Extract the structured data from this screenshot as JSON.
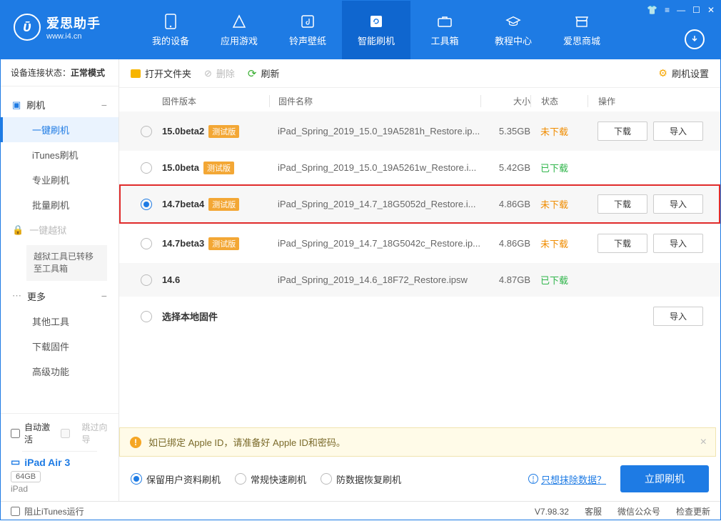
{
  "brand": {
    "name": "爱思助手",
    "site": "www.i4.cn"
  },
  "nav": {
    "items": [
      {
        "label": "我的设备"
      },
      {
        "label": "应用游戏"
      },
      {
        "label": "铃声壁纸"
      },
      {
        "label": "智能刷机"
      },
      {
        "label": "工具箱"
      },
      {
        "label": "教程中心"
      },
      {
        "label": "爱思商城"
      }
    ]
  },
  "sidebar": {
    "conn_label": "设备连接状态：",
    "conn_value": "正常模式",
    "flash_section": "刷机",
    "items": {
      "oneclick": "一键刷机",
      "itunes": "iTunes刷机",
      "pro": "专业刷机",
      "batch": "批量刷机",
      "jailbreak": "一键越狱",
      "jb_note": "越狱工具已转移至工具箱",
      "more": "更多",
      "other_tools": "其他工具",
      "download_fw": "下载固件",
      "advanced": "高级功能"
    },
    "auto_activate": "自动激活",
    "skip_guide": "跳过向导",
    "device_name": "iPad Air 3",
    "storage": "64GB",
    "device_type": "iPad"
  },
  "toolbar": {
    "open": "打开文件夹",
    "delete": "删除",
    "refresh": "刷新",
    "settings": "刷机设置"
  },
  "columns": {
    "version": "固件版本",
    "name": "固件名称",
    "size": "大小",
    "status": "状态",
    "ops": "操作"
  },
  "beta_tag": "测试版",
  "rows": [
    {
      "ver": "15.0beta2",
      "beta": true,
      "name": "iPad_Spring_2019_15.0_19A5281h_Restore.ip...",
      "size": "5.35GB",
      "status": "未下载",
      "st": "orange",
      "dl": true,
      "imp": true,
      "sel": false
    },
    {
      "ver": "15.0beta",
      "beta": true,
      "name": "iPad_Spring_2019_15.0_19A5261w_Restore.i...",
      "size": "5.42GB",
      "status": "已下载",
      "st": "green",
      "dl": false,
      "imp": false,
      "sel": false
    },
    {
      "ver": "14.7beta4",
      "beta": true,
      "name": "iPad_Spring_2019_14.7_18G5052d_Restore.i...",
      "size": "4.86GB",
      "status": "未下载",
      "st": "orange",
      "dl": true,
      "imp": true,
      "sel": true,
      "hl": true
    },
    {
      "ver": "14.7beta3",
      "beta": true,
      "name": "iPad_Spring_2019_14.7_18G5042c_Restore.ip...",
      "size": "4.86GB",
      "status": "未下载",
      "st": "orange",
      "dl": true,
      "imp": true,
      "sel": false
    },
    {
      "ver": "14.6",
      "beta": false,
      "name": "iPad_Spring_2019_14.6_18F72_Restore.ipsw",
      "size": "4.87GB",
      "status": "已下载",
      "st": "green",
      "dl": false,
      "imp": false,
      "sel": false
    }
  ],
  "local_row": "选择本地固件",
  "buttons": {
    "download": "下载",
    "import": "导入"
  },
  "notice": "如已绑定 Apple ID，请准备好 Apple ID和密码。",
  "options": {
    "keep_data": "保留用户资料刷机",
    "normal": "常规快速刷机",
    "anti_loss": "防数据恢复刷机",
    "erase_link": "只想抹除数据？",
    "flash_now": "立即刷机"
  },
  "footer": {
    "block_itunes": "阻止iTunes运行",
    "version": "V7.98.32",
    "service": "客服",
    "wechat": "微信公众号",
    "update": "检查更新"
  }
}
